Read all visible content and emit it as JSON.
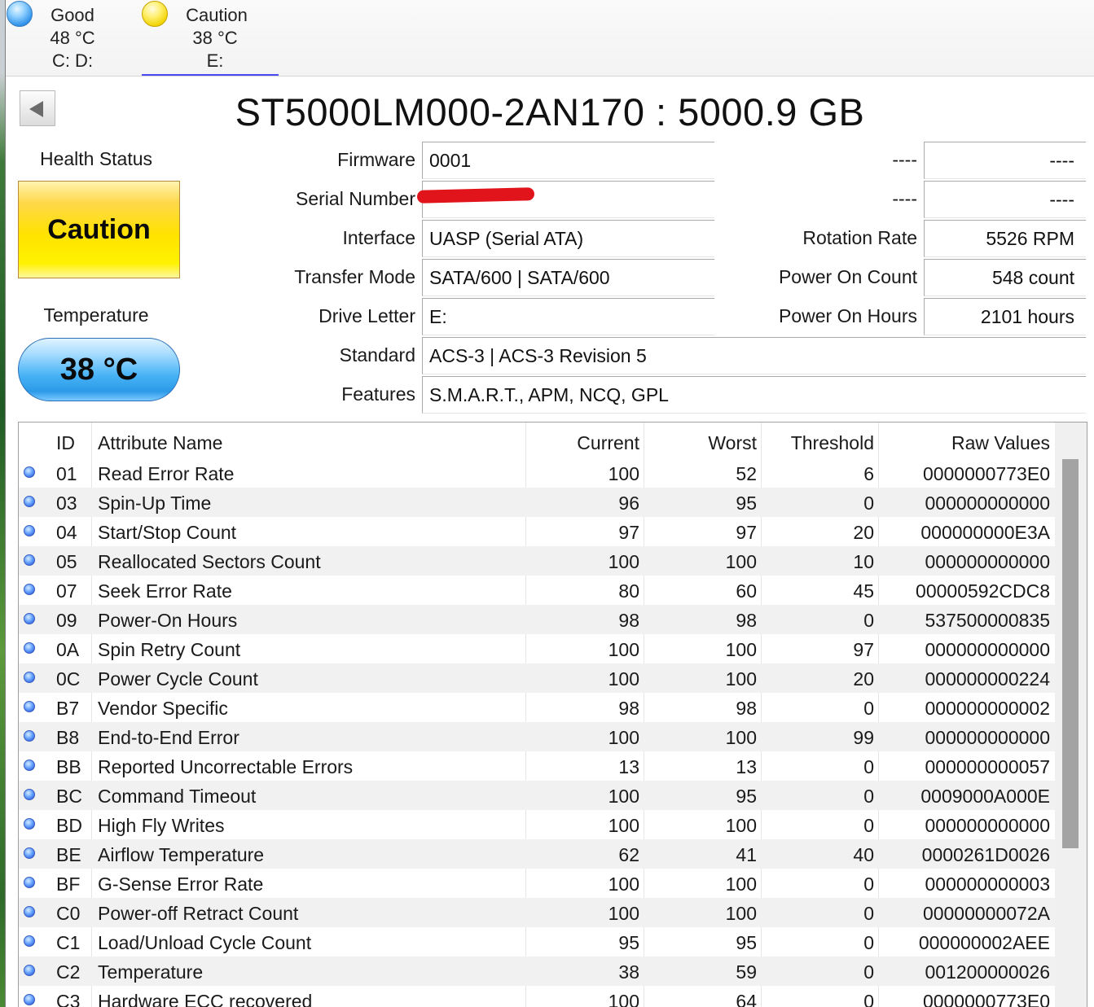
{
  "disks": [
    {
      "status": "Good",
      "temp": "48 °C",
      "letters": "C: D:",
      "color": "#2c8fe8",
      "icon": "blue-orb-icon"
    },
    {
      "status": "Caution",
      "temp": "38 °C",
      "letters": "E:",
      "color": "#f2d400",
      "icon": "yellow-orb-icon"
    }
  ],
  "drive": {
    "title": "ST5000LM000-2AN170 : 5000.9 GB"
  },
  "health": {
    "label": "Health Status",
    "value": "Caution",
    "color": "#ffe200"
  },
  "temperature": {
    "label": "Temperature",
    "value": "38 °C"
  },
  "info": {
    "firmware": {
      "label": "Firmware",
      "value": "0001"
    },
    "serial": {
      "label": "Serial Number",
      "value": ""
    },
    "interface": {
      "label": "Interface",
      "value": "UASP (Serial ATA)"
    },
    "transfer": {
      "label": "Transfer Mode",
      "value": "SATA/600 | SATA/600"
    },
    "letter": {
      "label": "Drive Letter",
      "value": "E:"
    },
    "standard": {
      "label": "Standard",
      "value": "ACS-3 | ACS-3 Revision 5"
    },
    "features": {
      "label": "Features",
      "value": "S.M.A.R.T., APM, NCQ, GPL"
    },
    "extra1": {
      "label": "----",
      "value": "----"
    },
    "extra2": {
      "label": "----",
      "value": "----"
    },
    "rotation": {
      "label": "Rotation Rate",
      "value": "5526 RPM"
    },
    "power_count": {
      "label": "Power On Count",
      "value": "548 count"
    },
    "power_hours": {
      "label": "Power On Hours",
      "value": "2101 hours"
    }
  },
  "smart": {
    "headers": {
      "id": "ID",
      "name": "Attribute Name",
      "current": "Current",
      "worst": "Worst",
      "threshold": "Threshold",
      "raw": "Raw Values"
    },
    "rows": [
      {
        "id": "01",
        "name": "Read Error Rate",
        "current": "100",
        "worst": "52",
        "threshold": "6",
        "raw": "0000000773E0"
      },
      {
        "id": "03",
        "name": "Spin-Up Time",
        "current": "96",
        "worst": "95",
        "threshold": "0",
        "raw": "000000000000"
      },
      {
        "id": "04",
        "name": "Start/Stop Count",
        "current": "97",
        "worst": "97",
        "threshold": "20",
        "raw": "000000000E3A"
      },
      {
        "id": "05",
        "name": "Reallocated Sectors Count",
        "current": "100",
        "worst": "100",
        "threshold": "10",
        "raw": "000000000000"
      },
      {
        "id": "07",
        "name": "Seek Error Rate",
        "current": "80",
        "worst": "60",
        "threshold": "45",
        "raw": "00000592CDC8"
      },
      {
        "id": "09",
        "name": "Power-On Hours",
        "current": "98",
        "worst": "98",
        "threshold": "0",
        "raw": "537500000835"
      },
      {
        "id": "0A",
        "name": "Spin Retry Count",
        "current": "100",
        "worst": "100",
        "threshold": "97",
        "raw": "000000000000"
      },
      {
        "id": "0C",
        "name": "Power Cycle Count",
        "current": "100",
        "worst": "100",
        "threshold": "20",
        "raw": "000000000224"
      },
      {
        "id": "B7",
        "name": "Vendor Specific",
        "current": "98",
        "worst": "98",
        "threshold": "0",
        "raw": "000000000002"
      },
      {
        "id": "B8",
        "name": "End-to-End Error",
        "current": "100",
        "worst": "100",
        "threshold": "99",
        "raw": "000000000000"
      },
      {
        "id": "BB",
        "name": "Reported Uncorrectable Errors",
        "current": "13",
        "worst": "13",
        "threshold": "0",
        "raw": "000000000057"
      },
      {
        "id": "BC",
        "name": "Command Timeout",
        "current": "100",
        "worst": "95",
        "threshold": "0",
        "raw": "0009000A000E"
      },
      {
        "id": "BD",
        "name": "High Fly Writes",
        "current": "100",
        "worst": "100",
        "threshold": "0",
        "raw": "000000000000"
      },
      {
        "id": "BE",
        "name": "Airflow Temperature",
        "current": "62",
        "worst": "41",
        "threshold": "40",
        "raw": "0000261D0026"
      },
      {
        "id": "BF",
        "name": "G-Sense Error Rate",
        "current": "100",
        "worst": "100",
        "threshold": "0",
        "raw": "000000000003"
      },
      {
        "id": "C0",
        "name": "Power-off Retract Count",
        "current": "100",
        "worst": "100",
        "threshold": "0",
        "raw": "00000000072A"
      },
      {
        "id": "C1",
        "name": "Load/Unload Cycle Count",
        "current": "95",
        "worst": "95",
        "threshold": "0",
        "raw": "000000002AEE"
      },
      {
        "id": "C2",
        "name": "Temperature",
        "current": "38",
        "worst": "59",
        "threshold": "0",
        "raw": "001200000026"
      },
      {
        "id": "C3",
        "name": "Hardware ECC recovered",
        "current": "100",
        "worst": "64",
        "threshold": "0",
        "raw": "0000000773E0"
      }
    ]
  }
}
